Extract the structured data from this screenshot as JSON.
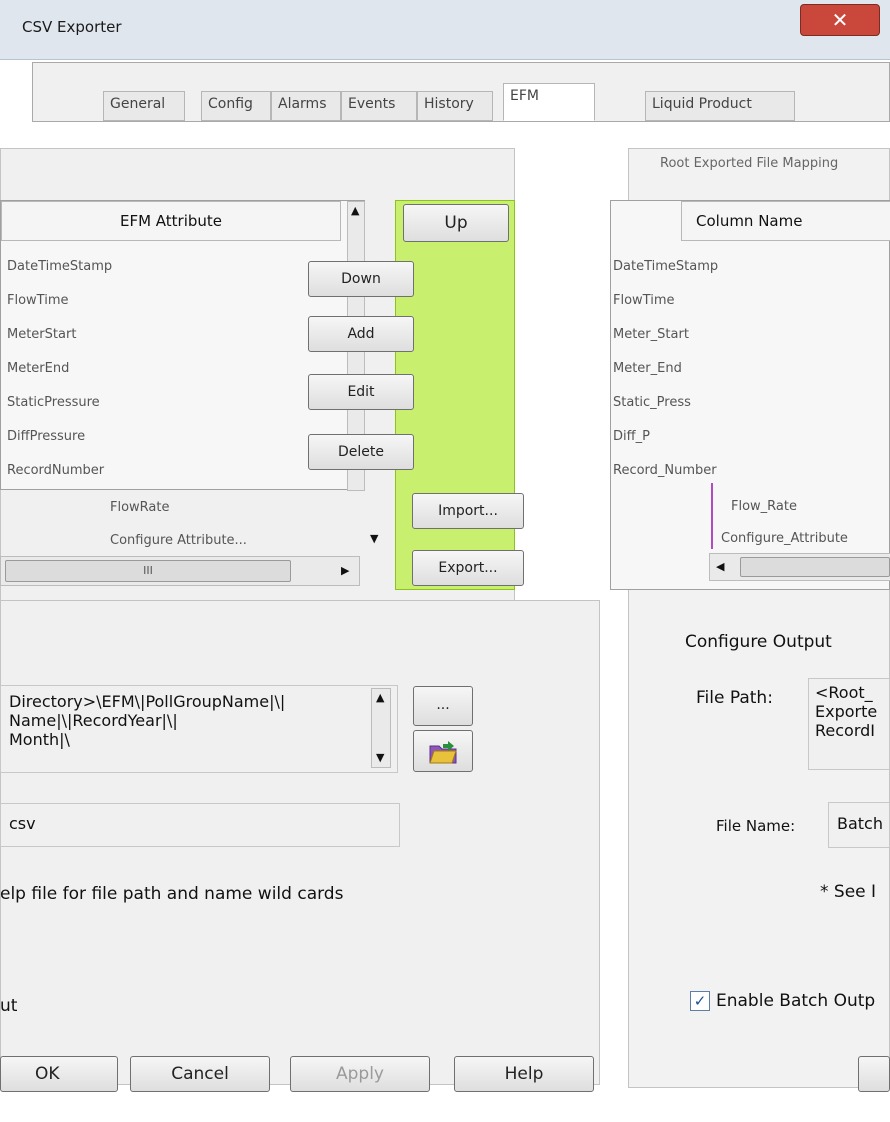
{
  "window": {
    "title": "CSV Exporter",
    "close_glyph": "✕"
  },
  "tabs": [
    {
      "label": "General"
    },
    {
      "label": "Config"
    },
    {
      "label": "Alarms"
    },
    {
      "label": "Events"
    },
    {
      "label": "History"
    },
    {
      "label": "EFM"
    },
    {
      "label": "Liquid Product"
    }
  ],
  "left_list": {
    "header": "EFM Attribute",
    "rows": [
      "DateTimeStamp",
      "FlowTime",
      "MeterStart",
      "MeterEnd",
      "StaticPressure",
      "DiffPressure",
      "RecordNumber"
    ],
    "trail_rows": [
      "FlowRate",
      "Configure Attribute..."
    ],
    "hscroll_label": "III"
  },
  "mid_buttons": {
    "up": "Up",
    "down": "Down",
    "add": "Add",
    "edit": "Edit",
    "delete": "Delete",
    "import": "Import...",
    "export": "Export..."
  },
  "right_list": {
    "group_label": "Root Exported File Mapping",
    "header": "Column Name",
    "rows": [
      "DateTimeStamp",
      "FlowTime",
      "Meter_Start",
      "Meter_End",
      "Static_Press",
      "Diff_P",
      "Record_Number"
    ],
    "trail_rows": [
      "Flow_Rate",
      "Configure_Attribute"
    ]
  },
  "left_output": {
    "path_lines": [
      "Directory>\\EFM\\|PollGroupName|\\|",
      "Name|\\|RecordYear|\\|",
      "Month|\\"
    ],
    "browse_label": "...",
    "file_ext": "csv",
    "help_note": "elp file for file path and name wild cards",
    "output_label": "ut"
  },
  "right_output": {
    "section_title": "Configure Output",
    "file_path_label": "File Path:",
    "file_path_lines": [
      "<Root_",
      "Exporte",
      "RecordI"
    ],
    "file_name_label": "File Name:",
    "file_name_value": "Batch",
    "see_note": "* See I",
    "enable_batch_label": "Enable Batch Outp",
    "enable_batch_checked": "✓"
  },
  "footer": {
    "ok": "OK",
    "cancel": "Cancel",
    "apply": "Apply",
    "help": "Help"
  }
}
